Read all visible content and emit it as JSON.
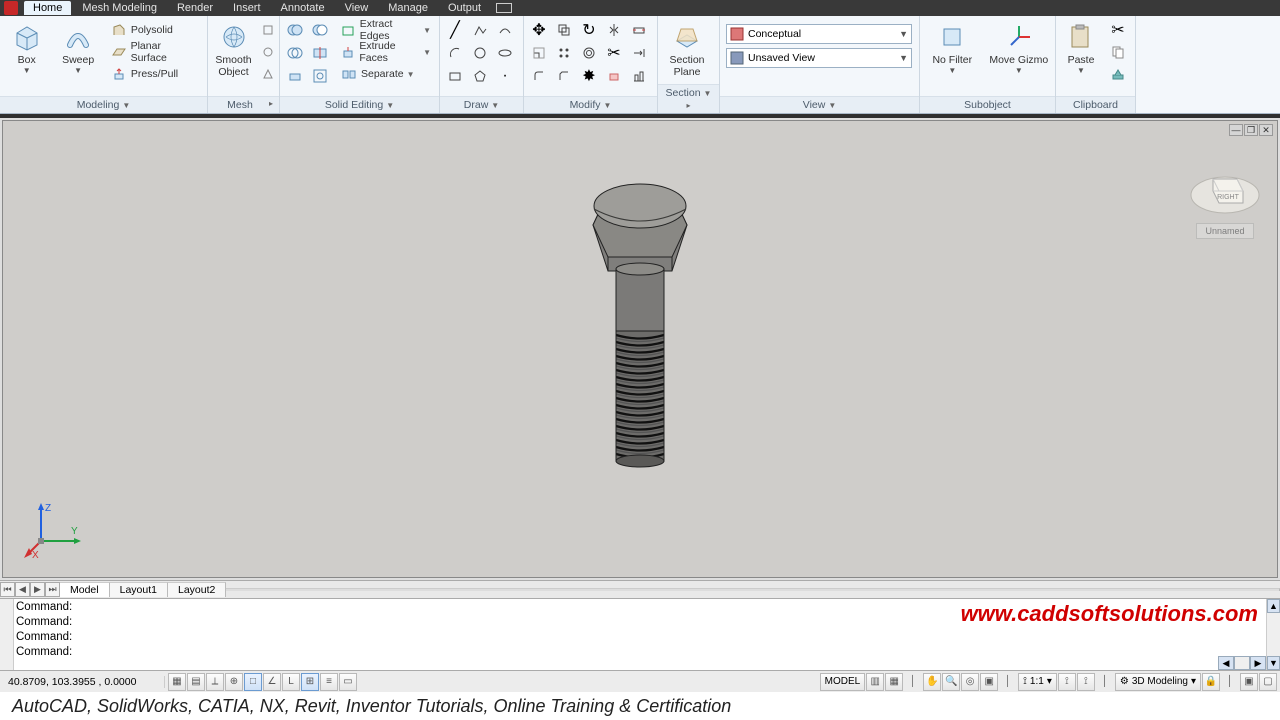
{
  "menu": {
    "tabs": [
      "Home",
      "Mesh Modeling",
      "Render",
      "Insert",
      "Annotate",
      "View",
      "Manage",
      "Output"
    ],
    "active": 0
  },
  "ribbon": {
    "modeling": {
      "title": "Modeling",
      "box": "Box",
      "sweep": "Sweep",
      "polysolid": "Polysolid",
      "planar": "Planar Surface",
      "presspull": "Press/Pull"
    },
    "mesh": {
      "title": "Mesh",
      "smooth": "Smooth\nObject"
    },
    "solid": {
      "title": "Solid Editing",
      "extract": "Extract Edges",
      "extrude": "Extrude Faces",
      "separate": "Separate"
    },
    "draw": {
      "title": "Draw"
    },
    "modify": {
      "title": "Modify"
    },
    "section": {
      "title": "Section",
      "plane": "Section\nPlane"
    },
    "view": {
      "title": "View",
      "visual": "Conceptual",
      "named": "Unsaved View"
    },
    "subobject": {
      "title": "Subobject",
      "nofilter": "No Filter",
      "gizmo": "Move Gizmo"
    },
    "clipboard": {
      "title": "Clipboard",
      "paste": "Paste"
    }
  },
  "canvas": {
    "viewcube_face": "RIGHT",
    "viewcube_label": "Unnamed",
    "axes": {
      "x": "X",
      "y": "Y",
      "z": "Z"
    }
  },
  "layout_tabs": [
    "Model",
    "Layout1",
    "Layout2"
  ],
  "layout_active": 0,
  "cmd_prompt": "Command:",
  "cmd_lines": 4,
  "watermark": "www.caddsoftsolutions.com",
  "status": {
    "coords": "40.8709,  103.3955 , 0.0000",
    "model_label": "MODEL",
    "scale": "1:1",
    "workspace": "3D Modeling"
  },
  "footer": "AutoCAD, SolidWorks, CATIA, NX, Revit, Inventor Tutorials, Online Training & Certification"
}
